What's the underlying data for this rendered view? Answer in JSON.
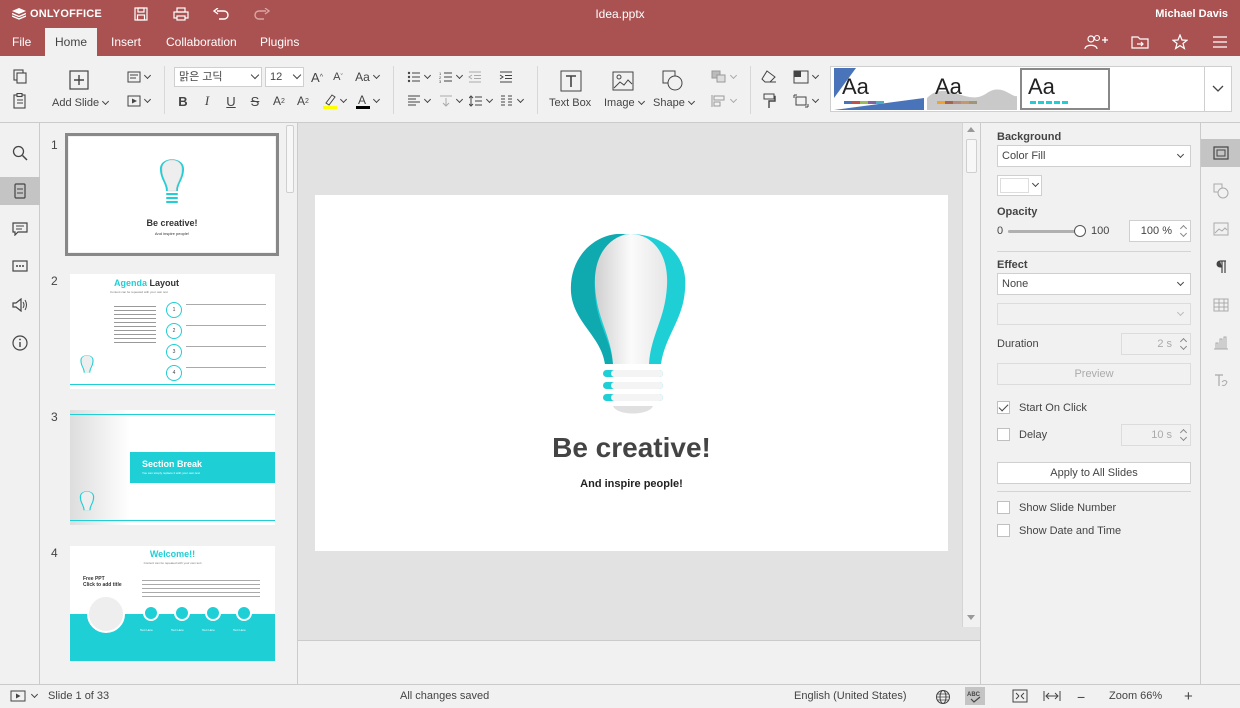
{
  "app": {
    "brand": "ONLYOFFICE",
    "doc_title": "Idea.pptx",
    "user": "Michael Davis",
    "brand_color": "#aa5252"
  },
  "menu": {
    "tabs": [
      "File",
      "Home",
      "Insert",
      "Collaboration",
      "Plugins"
    ],
    "active": "Home"
  },
  "toolbar": {
    "add_slide": "Add Slide",
    "font_name": "맑은 고딕",
    "font_size": "12",
    "change_case": "Aa",
    "text_box": "Text Box",
    "image": "Image",
    "shape": "Shape",
    "theme_sample": "Aa"
  },
  "slides_panel": {
    "thumbnails": [
      {
        "number": "1",
        "title": "Be creative!",
        "subtitle": "And inspire people!"
      },
      {
        "number": "2",
        "title_accent": "Agenda",
        "title_rest": "Layout",
        "subtitle": "Content can be repeated with your own text",
        "items": [
          "1",
          "2",
          "3",
          "4"
        ]
      },
      {
        "number": "3",
        "title": "Section Break",
        "subtitle": "You can simply replace it with your own text"
      },
      {
        "number": "4",
        "title": "Welcome!!",
        "subtitle": "Content can be repeated with your own text",
        "left_title": "Free PPT\nClick to add title",
        "items": [
          "Text Here",
          "Text Here",
          "Text Here",
          "Text Here"
        ]
      }
    ]
  },
  "slide": {
    "title": "Be creative!",
    "subtitle": "And inspire people!"
  },
  "settings": {
    "background_label": "Background",
    "background_value": "Color Fill",
    "opacity_label": "Opacity",
    "opacity_min": "0",
    "opacity_max": "100",
    "opacity_value": "100 %",
    "opacity_level": 1.0,
    "effect_label": "Effect",
    "effect_value": "None",
    "effect_type_value": "",
    "duration_label": "Duration",
    "duration_value": "2 s",
    "preview_label": "Preview",
    "start_on_click_label": "Start On Click",
    "start_on_click_checked": true,
    "delay_label": "Delay",
    "delay_checked": false,
    "delay_value": "10 s",
    "apply_all_label": "Apply to All Slides",
    "show_slide_number_label": "Show Slide Number",
    "show_date_time_label": "Show Date and Time"
  },
  "status": {
    "slide_counter": "Slide 1 of 33",
    "save_state": "All changes saved",
    "language": "English (United States)",
    "zoom": "Zoom 66%"
  },
  "colors": {
    "accent_cyan": "#1fcfd6",
    "chrome_bg": "#f1f1f1",
    "canvas_bg": "#e2e2e2"
  }
}
